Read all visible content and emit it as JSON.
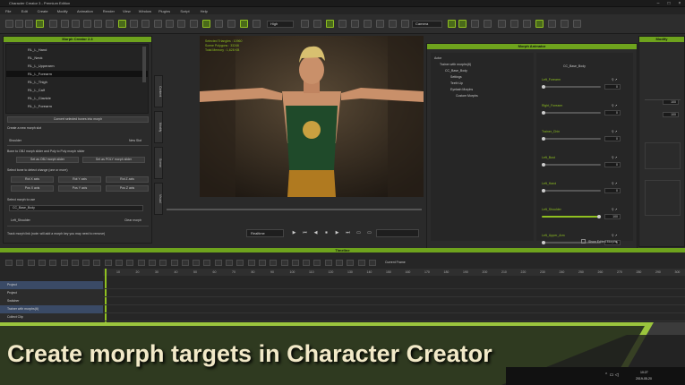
{
  "window": {
    "title": "Character Creator 3 - Premium Edition",
    "min": "–",
    "max": "□",
    "close": "×"
  },
  "menu": [
    "File",
    "Edit",
    "Create",
    "Modify",
    "Animation",
    "Render",
    "View",
    "Window",
    "Plugins",
    "Script",
    "Help"
  ],
  "toolbar": {
    "quality": "High",
    "camera": "Camera"
  },
  "morph_panel": {
    "title": "Morph Creator 2.3",
    "tree": [
      "RL_L_Hand",
      "RL_Neck",
      "RL_L_Upperarm",
      "RL_L_Forearm",
      "RL_L_Thigh",
      "RL_L_Calf",
      "RL_L_Clavicle",
      "RL_L_Forearm"
    ],
    "selected_index": 3,
    "btn_convert": "Convert selected bones into morph",
    "s1": "Create a new morph slot",
    "shoulder": "Shoulder",
    "new_slot": "New Slot",
    "s2": "Bone to OBJ morph slider and Poly to Poly morph slider",
    "btn_set_obj": "Set as OBJ morph slider",
    "btn_set_poly": "Set as POLY morph slider",
    "s3": "Select bone to detect change (one or more)",
    "axes": [
      [
        "Rot X axis",
        "Rot Y axis",
        "Rot Z axis"
      ],
      [
        "Pos X axis",
        "Pos Y axis",
        "Pos Z axis"
      ]
    ],
    "s4": "Select morph to use",
    "dd_morph": "CC_Base_Body",
    "left_shoulder": "Left_Shoulder",
    "clear_morph": "Clear morph",
    "s5": "Track morph link (note: will add a morph key you may need to remove)"
  },
  "side_tabs": [
    "Content",
    "Modify",
    "Scene",
    "Visual"
  ],
  "viewport": {
    "stats": [
      "Selected Triangles : 10960",
      "Scene Polygons : 33246",
      "Total Memory : 1,628 KB"
    ],
    "fit_label": "Realtime"
  },
  "morph_anim": {
    "title": "Morph Animator",
    "tree": [
      "Actor",
      "Trainer with morphs(6)",
      "CC_Base_Body",
      "Settings",
      "Teeth Up",
      "Eyelash Morphs",
      "Custom Morphs"
    ],
    "body_label": "CC_Base_Body",
    "sliders": [
      {
        "name": "Left_Forearm",
        "value": 0
      },
      {
        "name": "Right_Forearm",
        "value": 0
      },
      {
        "name": "Trainer_Chin",
        "value": 0
      },
      {
        "name": "Left_Bust",
        "value": 0
      },
      {
        "name": "Left_Hand",
        "value": 0
      },
      {
        "name": "Left_Shoulder",
        "value": 100
      },
      {
        "name": "Left_Upper_Arm",
        "value": 0
      }
    ],
    "show_edited": "Show Edited Morphs",
    "default_key": "Default Key"
  },
  "right_panel": {
    "title": "Modify",
    "vals": [
      "100",
      "100"
    ]
  },
  "timeline": {
    "title": "Timeline",
    "current_frame": "Current Frame",
    "tracks": [
      "Project",
      "Project",
      "Switcher",
      "Trainer with morphs(6)",
      "Collect Clip"
    ],
    "ticks": [
      "10",
      "20",
      "30",
      "40",
      "50",
      "60",
      "70",
      "80",
      "90",
      "100",
      "110",
      "120",
      "130",
      "140",
      "150",
      "160",
      "170",
      "180",
      "190",
      "200",
      "210",
      "220",
      "230",
      "240",
      "250",
      "260",
      "270",
      "280",
      "290",
      "300"
    ]
  },
  "banner": {
    "text": "Create morph targets in Character Creator"
  },
  "taskbar": {
    "time": "10:27",
    "date": "2019-05-20"
  },
  "colors": {
    "accent": "#6ea31d",
    "banner_green": "#9bc53d"
  }
}
